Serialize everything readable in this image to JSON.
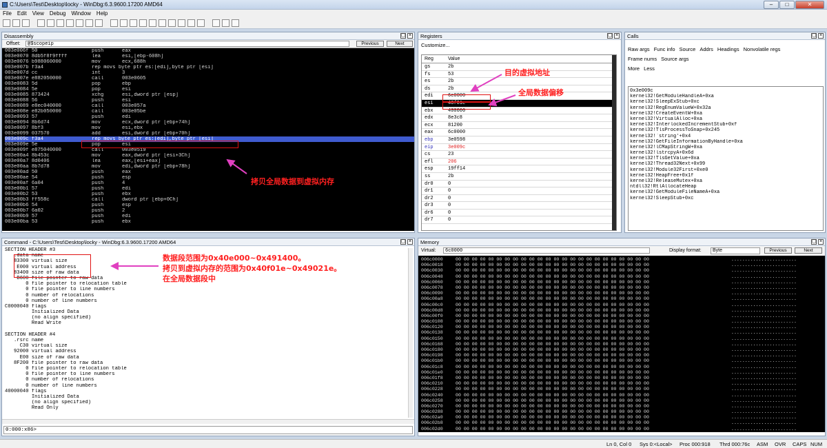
{
  "window": {
    "title": "C:\\Users\\Test\\Desktop\\locky - WinDbg:6.3.9600.17200 AMD64",
    "min": "–",
    "max": "□",
    "close": "✕"
  },
  "menu": [
    "File",
    "Edit",
    "View",
    "Debug",
    "Window",
    "Help"
  ],
  "toolbar_icons": [
    "open-icon",
    "step-icon",
    "go-icon",
    "break-icon",
    "restart-icon",
    "stop-icon",
    "step-into-icon",
    "step-over-icon",
    "step-out-icon",
    "run-to-cursor-icon",
    "hand-icon",
    "command-icon",
    "watch-icon",
    "locals-icon",
    "registers-icon",
    "memory-icon",
    "callstack-icon",
    "disassembly-icon",
    "scratch-icon",
    "process-icon",
    "source-mode-icon",
    "font-icon",
    "options-icon"
  ],
  "disasm": {
    "title": "Disassembly",
    "offset_label": "Offset:",
    "offset": "@$scopeip",
    "prev": "Previous",
    "next": "Next",
    "lines": [
      [
        "003e006f 50",
        "push",
        "eax"
      ],
      [
        "003e0070 8db5f8f9ffff",
        "lea",
        "esi,[ebp-608h]"
      ],
      [
        "003e0076 b988060000",
        "mov",
        "ecx,688h"
      ],
      [
        "003e007b f3a4",
        "rep movs byte ptr es:[edi],byte ptr [esi]",
        ""
      ],
      [
        "003e007d cc",
        "int",
        "3"
      ],
      [
        "003e007e e882050000",
        "call",
        "003e0605"
      ],
      [
        "003e0083 5d",
        "pop",
        "ebp"
      ],
      [
        "003e0084 5e",
        "pop",
        "esi"
      ],
      [
        "003e0085 873424",
        "xchg",
        "esi,dword ptr [esp]"
      ],
      [
        "003e0088 56",
        "push",
        "esi"
      ],
      [
        "003e0089 e8ec040000",
        "call",
        "003e057a"
      ],
      [
        "003e008e e82b050000",
        "call",
        "003e05be"
      ],
      [
        "003e0093 57",
        "push",
        "edi"
      ],
      [
        "003e0094 8b6d74",
        "mov",
        "ecx,dword ptr [ebp+74h]"
      ],
      [
        "003e0097 8bf3",
        "mov",
        "esi,ebx"
      ],
      [
        "003e0099 037570",
        "add",
        "esi,dword ptr [ebp+70h]"
      ],
      [
        "003e009c f3a4",
        "rep movs byte ptr es:[edi],byte ptr [esi]",
        ""
      ],
      [
        "003e009e 5e",
        "pop",
        "esi"
      ],
      [
        "003e009f e875040000",
        "call",
        "003e0519"
      ],
      [
        "003e00a4 8b453c",
        "mov",
        "eax,dword ptr [esi+3Ch]"
      ],
      [
        "003e00a7 8d0406",
        "lea",
        "eax,[esi+eax]"
      ],
      [
        "003e00aa 8b7d78",
        "mov",
        "edi,dword ptr [ebp+78h]"
      ],
      [
        "003e00ad 50",
        "push",
        "eax"
      ],
      [
        "003e00ae 54",
        "push",
        "esp"
      ],
      [
        "003e00af 6a04",
        "push",
        "4"
      ],
      [
        "003e00b1 57",
        "push",
        "edi"
      ],
      [
        "003e00b2 53",
        "push",
        "ebx"
      ],
      [
        "003e00b3 ff558c",
        "call",
        "dword ptr [ebp+0Ch]"
      ],
      [
        "003e00b6 54",
        "push",
        "esp"
      ],
      [
        "003e00b7 6a02",
        "push",
        "2"
      ],
      [
        "003e00b9 57",
        "push",
        "edi"
      ],
      [
        "003e00ba 53",
        "push",
        "ebx"
      ]
    ]
  },
  "regs": {
    "title": "Registers",
    "customize": "Customize...",
    "col_reg": "Reg",
    "col_val": "Value",
    "rows": [
      [
        "gs",
        "2b"
      ],
      [
        "fs",
        "53"
      ],
      [
        "es",
        "2b"
      ],
      [
        "ds",
        "2b"
      ],
      [
        "edi",
        "6c0000"
      ],
      [
        "esi",
        "40f01e"
      ],
      [
        "ebx",
        "400000"
      ],
      [
        "edx",
        "8e3c8"
      ],
      [
        "ecx",
        "81200"
      ],
      [
        "eax",
        "6c0000"
      ],
      [
        "ebp",
        "3e0598"
      ],
      [
        "eip",
        "3e009c"
      ],
      [
        "cs",
        "23"
      ],
      [
        "efl",
        "206"
      ],
      [
        "esp",
        "19ff14"
      ],
      [
        "ss",
        "2b"
      ],
      [
        "dr0",
        "0"
      ],
      [
        "dr1",
        "0"
      ],
      [
        "dr2",
        "0"
      ],
      [
        "dr3",
        "0"
      ],
      [
        "dr6",
        "0"
      ],
      [
        "dr7",
        "0"
      ]
    ]
  },
  "calls": {
    "title": "Calls",
    "tabs": [
      "Raw args",
      "Func info",
      "Source",
      "Addrs",
      "Headings",
      "Nonvolatile regs"
    ],
    "tabs2": [
      "Frame nums",
      "Source args"
    ],
    "tabs3": [
      "More",
      "Less"
    ],
    "frames": [
      "0x3e009c",
      "kernel32!GetModuleHandleA+0xa",
      "kernel32!SleepExStub+0xc",
      "kernel32!RegEnumValueW+0x32a",
      "kernel32!CreateEventW+0xa",
      "kernel32!VirtualAlloc+0xa",
      "kernel32!InterlockedIncrementStub+0xf",
      "kernel32!TlsProcessToSnap+0x245",
      "kernel32!`string'+0x4",
      "kernel32!GetFileInformationByHandle+0xa",
      "kernel32!lCMapStringW+0xa",
      "kernel32!lstrcpyA+0x6d",
      "kernel32!TlsGetValue+0xa",
      "kernel32!Thread32Next+0x99",
      "kernel32!Module32First+0xe0",
      "kernel32!HeapFree+0x1f",
      "kernel32!ReleaseMutex+0xa",
      "ntdll32!RtlAllocateHeap",
      "kernel32!GetModuleFileNameA+0xa",
      "kernel32!SleepStub+0xc"
    ]
  },
  "command": {
    "title": "Command - C:\\Users\\Test\\Desktop\\locky - WinDbg:6.3.9600.17200 AMD64",
    "prompt": "0:000:x86>",
    "lines": [
      "SECTION HEADER #3",
      "   .data name",
      "   83300 virtual size",
      "    E000 virtual address",
      "   83400 size of raw data",
      "    B600 file pointer to raw data",
      "       0 file pointer to relocation table",
      "       0 file pointer to line numbers",
      "       0 number of relocations",
      "       0 number of line numbers",
      "C0000040 flags",
      "         Initialized Data",
      "         (no align specified)",
      "         Read Write",
      "",
      "SECTION HEADER #4",
      "   .rsrc name",
      "     C30 virtual size",
      "   92000 virtual address",
      "     E00 size of raw data",
      "   8F200 file pointer to raw data",
      "       0 file pointer to relocation table",
      "       0 file pointer to line numbers",
      "       0 number of relocations",
      "       0 number of line numbers",
      "40000040 flags",
      "         Initialized Data",
      "         (no align specified)",
      "         Read Only"
    ]
  },
  "memory": {
    "title": "Memory",
    "virtual_label": "Virtual:",
    "virtual": "6c0000",
    "fmt_label": "Display format:",
    "fmt": "Byte",
    "prev": "Previous",
    "next": "Next",
    "addrs": [
      "006c0000",
      "006c0018",
      "006c0030",
      "006c0048",
      "006c0060",
      "006c0078",
      "006c0090",
      "006c00a8",
      "006c00c0",
      "006c00d8",
      "006c00f0",
      "006c0108",
      "006c0120",
      "006c0138",
      "006c0150",
      "006c0168",
      "006c0180",
      "006c0198",
      "006c01b0",
      "006c01c8",
      "006c01e0",
      "006c01f8",
      "006c0210",
      "006c0228",
      "006c0240",
      "006c0258",
      "006c0270",
      "006c0288",
      "006c02a0",
      "006c02b8",
      "006c02d0"
    ],
    "bytes": "00 00 00 00 00 00 00 00 00 00 00 00 00 00 00 00 00 00 00 00 00 00 00 00",
    "ascii": "........................"
  },
  "annotations": {
    "dst": "目的虚拟地址",
    "off": "全局数据偏移",
    "copy": "拷贝全局数据到虚拟内存",
    "range1": "数据段范围为0x40e000~0x491400。",
    "range2": "拷贝到虚拟内存的范围为0x40f01e~0x49021e。",
    "range3": "在全局数据段中"
  },
  "status": [
    "Ln 0, Col 0",
    "Sys 0:<Local>",
    "Proc 000:918",
    "Thrd 000:76c",
    "ASM",
    "OVR",
    "CAPS",
    "NUM"
  ]
}
